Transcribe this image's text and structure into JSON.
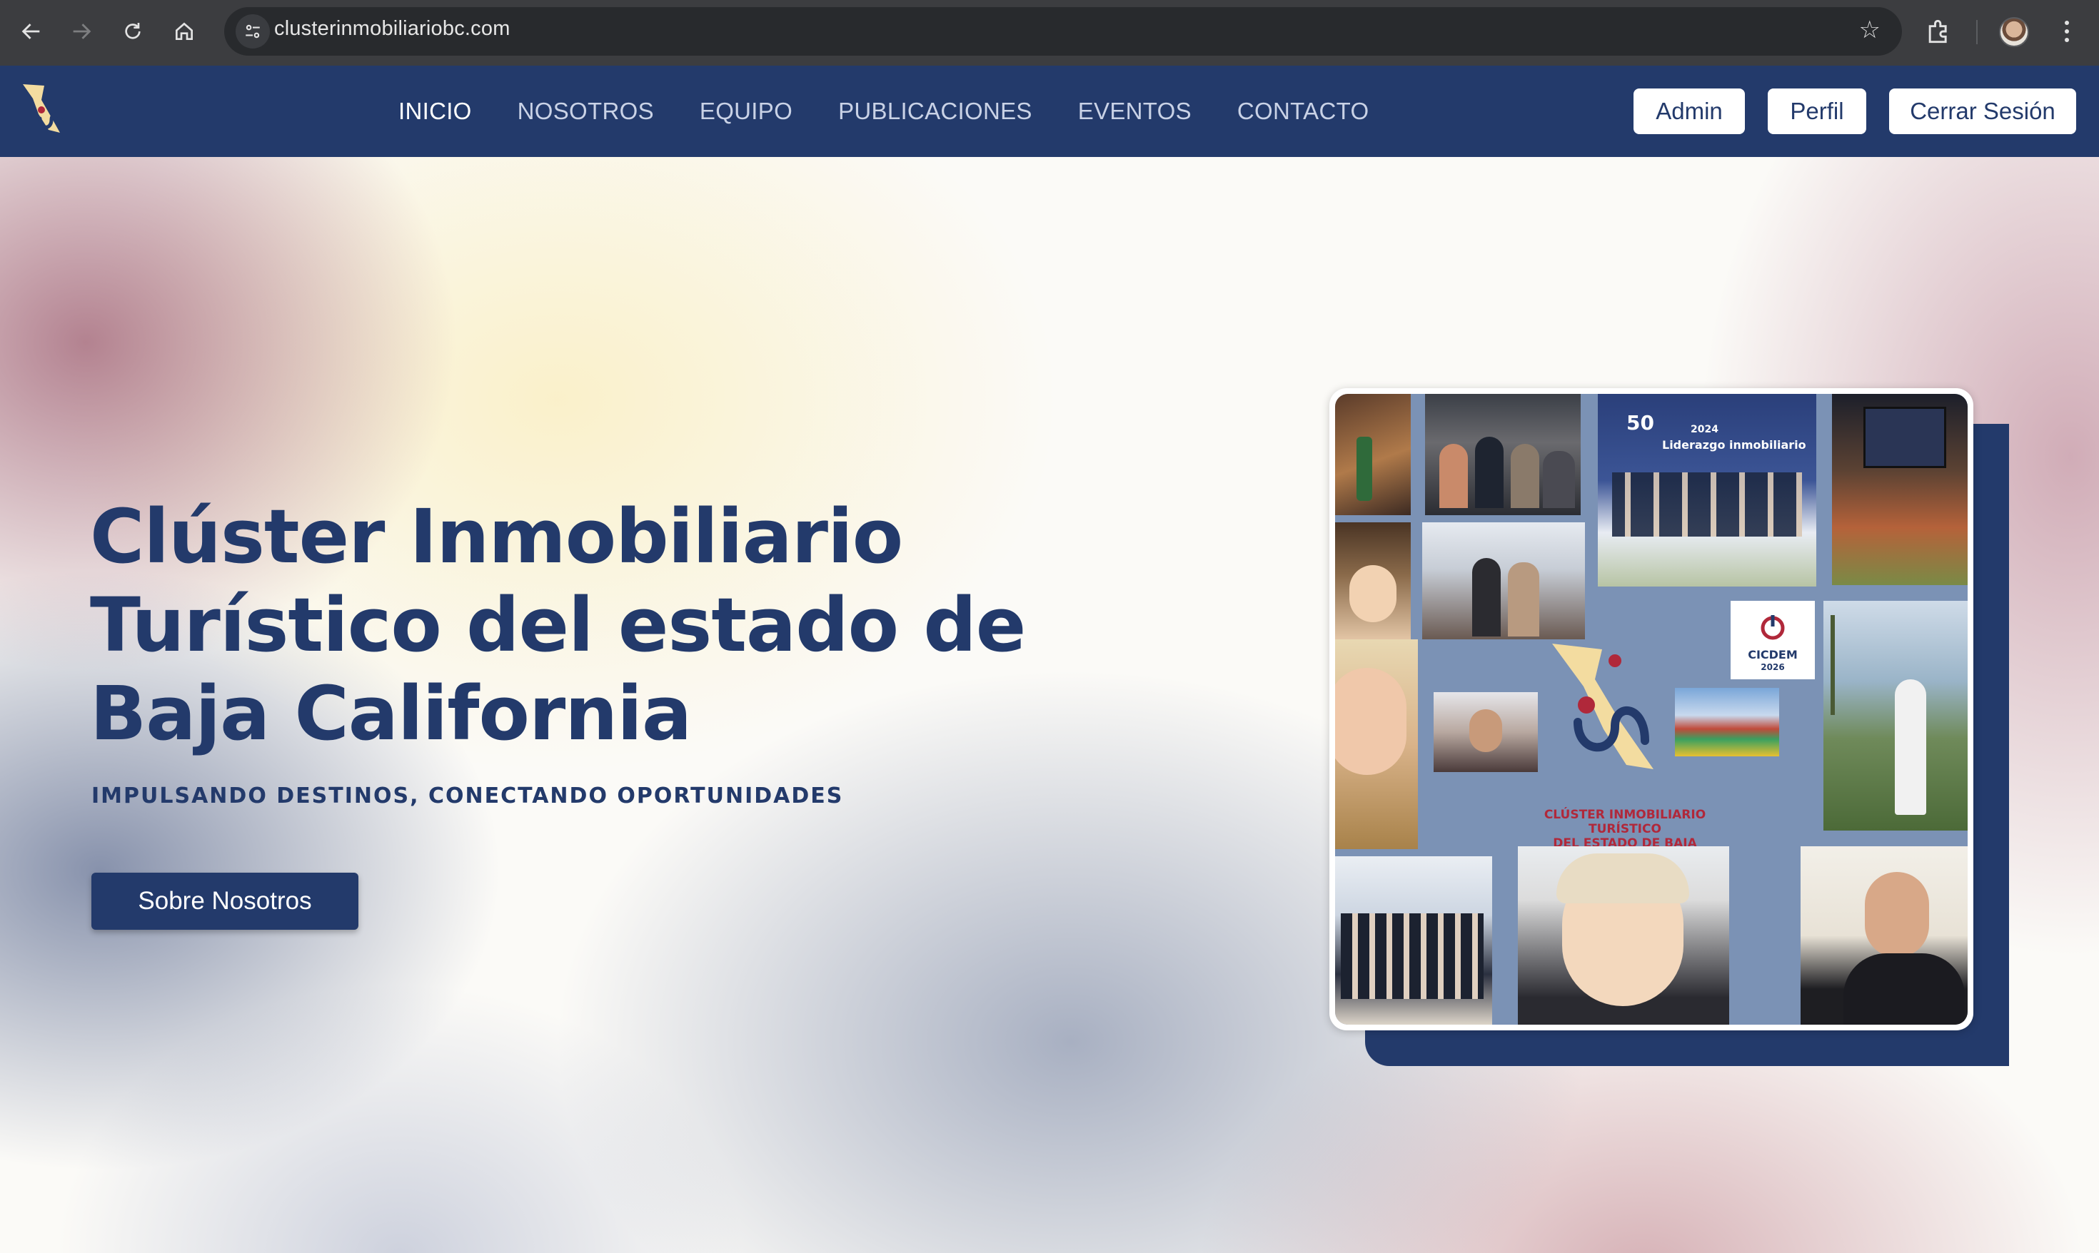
{
  "browser": {
    "url": "clusterinmobiliariobc.com"
  },
  "header": {
    "nav": [
      "INICIO",
      "NOSOTROS",
      "EQUIPO",
      "PUBLICACIONES",
      "EVENTOS",
      "CONTACTO"
    ],
    "active": "INICIO",
    "buttons": {
      "admin": "Admin",
      "perfil": "Perfil",
      "logout": "Cerrar Sesión"
    }
  },
  "hero": {
    "title": "Clúster Inmobiliario Turístico del estado de Baja California",
    "subtitle": "IMPULSANDO DESTINOS, CONECTANDO OPORTUNIDADES",
    "cta": "Sobre Nosotros"
  },
  "collage": {
    "logo_text_1": "CLÚSTER INMOBILIARIO TURÍSTICO",
    "logo_text_2": "DEL ESTADO DE BAJA CALIFORNIA",
    "cicdem_name": "CICDEM",
    "cicdem_year": "2026",
    "event_number": "50",
    "event_year": "2024",
    "event_title": "Liderazgo inmobiliario"
  },
  "colors": {
    "brand_navy": "#233a6b",
    "accent_red": "#b0283a",
    "accent_cream": "#f3dca0"
  }
}
